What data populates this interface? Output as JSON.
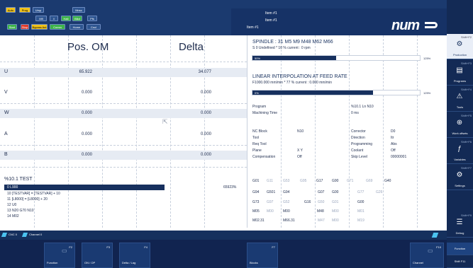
{
  "top_buttons": [
    {
      "label": "Auto",
      "color": "#f0c21a",
      "text": "#000"
    },
    {
      "label": "Prog",
      "color": "#f0c21a",
      "text": "#000"
    },
    {
      "label": "Ursp",
      "color": "#2e5590",
      "text": "#fff"
    },
    {
      "label": "Mnsc",
      "color": "#2e5590",
      "text": "#fff"
    },
    {
      "label": "Mfl",
      "color": "#2e5590",
      "text": "#fff"
    },
    {
      "label": "//",
      "color": "#2e5590",
      "text": "#fff"
    },
    {
      "label": "Halt",
      "color": "#3db34a",
      "text": "#fff"
    },
    {
      "label": "Blkd",
      "color": "#3db34a",
      "text": "#fff"
    },
    {
      "label": "Pfk",
      "color": "#2e5590",
      "text": "#fff"
    },
    {
      "label": "Start",
      "color": "#3db34a",
      "text": "#fff"
    },
    {
      "label": "Stop",
      "color": "#e03a2a",
      "text": "#fff"
    },
    {
      "label": "Bypass Aut",
      "color": "#f0c21a",
      "text": "#000"
    },
    {
      "label": "Comm",
      "color": "#3db34a",
      "text": "#fff"
    },
    {
      "label": "Home",
      "color": "#2e5590",
      "text": "#fff"
    },
    {
      "label": "Cncl",
      "color": "#2e5590",
      "text": "#fff"
    }
  ],
  "mode_lines": [
    "Item #1",
    "Item #1",
    "Item #1"
  ],
  "logo": "num",
  "position": {
    "pos_header": "Pos. OM",
    "delta_header": "Delta",
    "axes": [
      {
        "name": "U",
        "pos": "65.922",
        "delta": "34.077"
      },
      {
        "name": "V",
        "pos": "0.000",
        "delta": "0.000"
      },
      {
        "name": "W",
        "pos": "0.000",
        "delta": "0.000"
      },
      {
        "name": "A",
        "pos": "0.000",
        "delta": "0.000"
      },
      {
        "name": "B",
        "pos": "0.000",
        "delta": "0.000"
      }
    ]
  },
  "program": {
    "title": "%10.1 TEST",
    "current_line": "0  L900",
    "progress_label": "65923%",
    "progress": 1.0,
    "lines": [
      "10   [TESTVAR] = [TESTVAR] + 10",
      "11   [L8000] = [L8000] + 20",
      "12   U0",
      "13   N20 G70 N10",
      "14   M02"
    ]
  },
  "spindle": {
    "title": "SPINDLE : 31 M5 M9 M48 M62 M66",
    "sub": "S 0 Undefined * 10 % current : 0 rpm",
    "bar_label": "50%",
    "bar_fraction": 0.5,
    "bar_max": "125%"
  },
  "feed": {
    "title": "LINEAR INTERPOLATION AT FEED RATE",
    "sub": "F1000.000 mm/min * 77 % current : 0.000 mm/min",
    "bar_label": "0%",
    "bar_fraction": 0.0,
    "bar_max": "125%"
  },
  "info": {
    "program_label": "Program",
    "program_value": "%10.1 Ln N10",
    "machining_label": "Machining Time",
    "machining_value": "0 ms",
    "nc_rows": [
      {
        "l1": "NC Block",
        "v1": "N10",
        "l2": "Corrector",
        "v2": "D0"
      },
      {
        "l1": "Tool",
        "v1": "",
        "l2": "Direction",
        "v2": "Itr"
      },
      {
        "l1": "Req Tool",
        "v1": "",
        "l2": "Programming",
        "v2": "Abs"
      },
      {
        "l1": "Plane",
        "v1": "X Y",
        "l2": "Coolant",
        "v2": "Off"
      },
      {
        "l1": "Compensation",
        "v1": "Off",
        "l2": "Skip Level",
        "v2": "00000001"
      }
    ]
  },
  "gcodes": [
    {
      "t": "G01",
      "d": false
    },
    {
      "t": "G11",
      "d": true
    },
    {
      "t": "G53",
      "d": true
    },
    {
      "t": "G95",
      "d": true
    },
    {
      "t": "G17",
      "d": false
    },
    {
      "t": "G90",
      "d": false
    },
    {
      "t": "G71",
      "d": true
    },
    {
      "t": "G69",
      "d": true
    },
    {
      "t": "G40",
      "d": false
    },
    {
      "t": "G94",
      "d": false
    },
    {
      "t": "G501",
      "d": false
    },
    {
      "t": "G94",
      "d": false
    },
    {
      "t": "G07",
      "d": false
    },
    {
      "t": "G00",
      "d": false
    },
    {
      "t": "G77",
      "d": true
    },
    {
      "t": "G26",
      "d": true
    },
    {
      "t": "G73",
      "d": false
    },
    {
      "t": "G97",
      "d": true
    },
    {
      "t": "G52",
      "d": true
    },
    {
      "t": "G16",
      "d": false
    },
    {
      "t": "G50",
      "d": true
    },
    {
      "t": "G01",
      "d": true
    },
    {
      "t": "G00",
      "d": false
    },
    {
      "t": "M05",
      "d": false
    },
    {
      "t": "M00",
      "d": true
    },
    {
      "t": "M00",
      "d": false
    },
    {
      "t": "M48",
      "d": false
    },
    {
      "t": "M00",
      "d": true
    },
    {
      "t": "M01",
      "d": true
    },
    {
      "t": "M02.31",
      "d": false
    },
    {
      "t": "M66.31",
      "d": false
    },
    {
      "t": "M47",
      "d": true
    },
    {
      "t": "M00",
      "d": true
    },
    {
      "t": "M19",
      "d": true
    }
  ],
  "channel_tags": [
    "CNC 0",
    "Channel 0"
  ],
  "fkeys": [
    {
      "num": "F2",
      "label": "Function"
    },
    {
      "num": "F3",
      "label": "ON / OP"
    },
    {
      "num": "F4",
      "label": "Delta / Lag"
    },
    {
      "num": "F7",
      "label": "Blocks"
    },
    {
      "num": "F10",
      "label": "Channel"
    }
  ],
  "right_panel": [
    {
      "fk": "Shift+F2",
      "label": "Production",
      "icon": "⚙"
    },
    {
      "fk": "Shift+F3",
      "label": "Programs",
      "icon": "▤"
    },
    {
      "fk": "Shift+F4",
      "label": "Tools",
      "icon": "⚠"
    },
    {
      "fk": "Shift+F5",
      "label": "Work offsets",
      "icon": "⊕"
    },
    {
      "fk": "Shift+F6",
      "label": "Variables",
      "icon": "ƒ"
    },
    {
      "fk": "Shift+F7",
      "label": "Settings",
      "icon": "⚙"
    },
    {
      "fk": "Shift+F9",
      "label": "Debug",
      "icon": "☰"
    },
    {
      "fk": "",
      "label": "Function",
      "icon": ""
    },
    {
      "fk": "",
      "label": "Shift F11",
      "icon": ""
    }
  ]
}
